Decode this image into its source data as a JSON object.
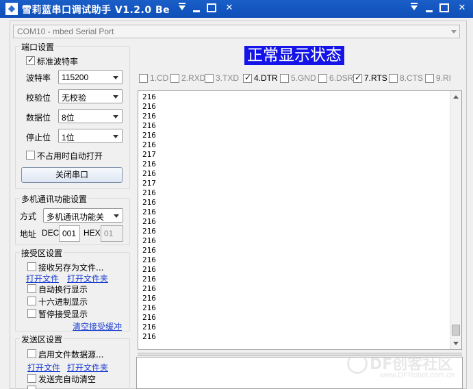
{
  "window": {
    "title": "雪莉蓝串口调试助手 V1.2.0 Be"
  },
  "port_selector": {
    "value": "COM10 - mbed Serial Port"
  },
  "port_settings": {
    "group_title": "端口设置",
    "standard_baud_label": "标准波特率",
    "standard_baud_checked": true,
    "baud_label": "波特率",
    "baud_value": "115200",
    "parity_label": "校验位",
    "parity_value": "无校验",
    "databits_label": "数据位",
    "databits_value": "8位",
    "stopbits_label": "停止位",
    "stopbits_value": "1位",
    "auto_open_label": "不占用时自动打开",
    "auto_open_checked": false,
    "close_port_button": "关闭串口"
  },
  "multi_machine": {
    "group_title": "多机通讯功能设置",
    "mode_label": "方式",
    "mode_value": "多机通讯功能关",
    "address_label": "地址",
    "dec_label": "DEC",
    "dec_value": "001",
    "hex_label": "HEX",
    "hex_value": "01"
  },
  "receive_settings": {
    "group_title": "接受区设置",
    "save_to_file_label": "接收另存为文件...",
    "open_file_link": "打开文件",
    "open_folder_link": "打开文件夹",
    "auto_newline_label": "自动换行显示",
    "hex_display_label": "十六进制显示",
    "pause_label": "暂停接受显示",
    "clear_link": "清空接受缓冲"
  },
  "send_settings": {
    "group_title": "发送区设置",
    "file_source_label": "启用文件数据源...",
    "open_file_link": "打开文件",
    "open_folder_link": "打开文件夹",
    "auto_clear_label": "发送完自动清空"
  },
  "status_banner": "正常显示状态",
  "pins": [
    {
      "name": "1.CD",
      "checked": false,
      "active": false
    },
    {
      "name": "2.RXD",
      "checked": false,
      "active": false
    },
    {
      "name": "3.TXD",
      "checked": false,
      "active": false
    },
    {
      "name": "4.DTR",
      "checked": true,
      "active": true
    },
    {
      "name": "5.GND",
      "checked": false,
      "active": false
    },
    {
      "name": "6.DSR",
      "checked": false,
      "active": false
    },
    {
      "name": "7.RTS",
      "checked": true,
      "active": true
    },
    {
      "name": "8.CTS",
      "checked": false,
      "active": false
    },
    {
      "name": "9.RI",
      "checked": false,
      "active": false
    }
  ],
  "receive_lines": [
    "216",
    "216",
    "216",
    "216",
    "216",
    "216",
    "217",
    "216",
    "216",
    "217",
    "216",
    "216",
    "216",
    "216",
    "216",
    "216",
    "216",
    "216",
    "216",
    "216",
    "216",
    "216",
    "216",
    "216",
    "216",
    "216"
  ],
  "watermark": {
    "text": "DF创客社区",
    "url": "www.DFRobot.com.cn"
  },
  "colors": {
    "titlebar": "#1a5ec8",
    "banner_bg": "#1414e8",
    "link": "#1c3fd1"
  }
}
